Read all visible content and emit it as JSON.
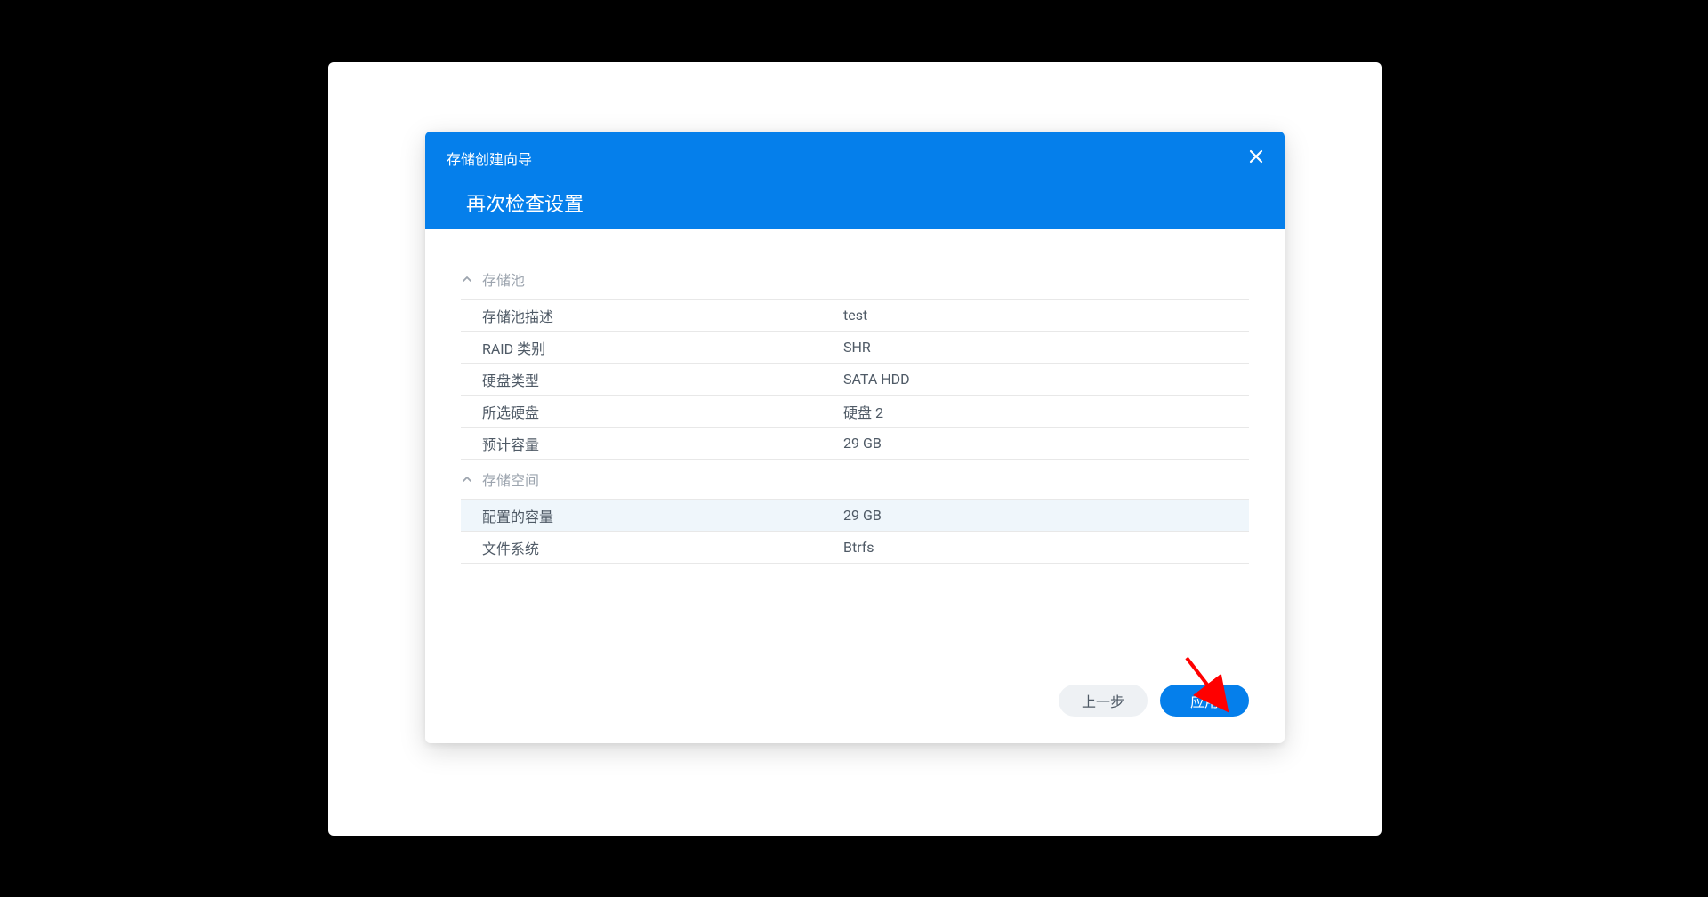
{
  "dialog": {
    "title_small": "存储创建向导",
    "title_large": "再次检查设置"
  },
  "sections": {
    "pool": {
      "header": "存储池",
      "rows": {
        "desc": {
          "label": "存储池描述",
          "value": "test"
        },
        "raid": {
          "label": "RAID 类别",
          "value": "SHR"
        },
        "disk_type": {
          "label": "硬盘类型",
          "value": "SATA HDD"
        },
        "selected": {
          "label": "所选硬盘",
          "value": "硬盘 2"
        },
        "est_capacity": {
          "label": "预计容量",
          "value": "29 GB"
        }
      }
    },
    "volume": {
      "header": "存储空间",
      "rows": {
        "alloc_capacity": {
          "label": "配置的容量",
          "value": "29 GB"
        },
        "filesystem": {
          "label": "文件系统",
          "value": "Btrfs"
        }
      }
    }
  },
  "footer": {
    "back": "上一步",
    "apply": "应用"
  }
}
